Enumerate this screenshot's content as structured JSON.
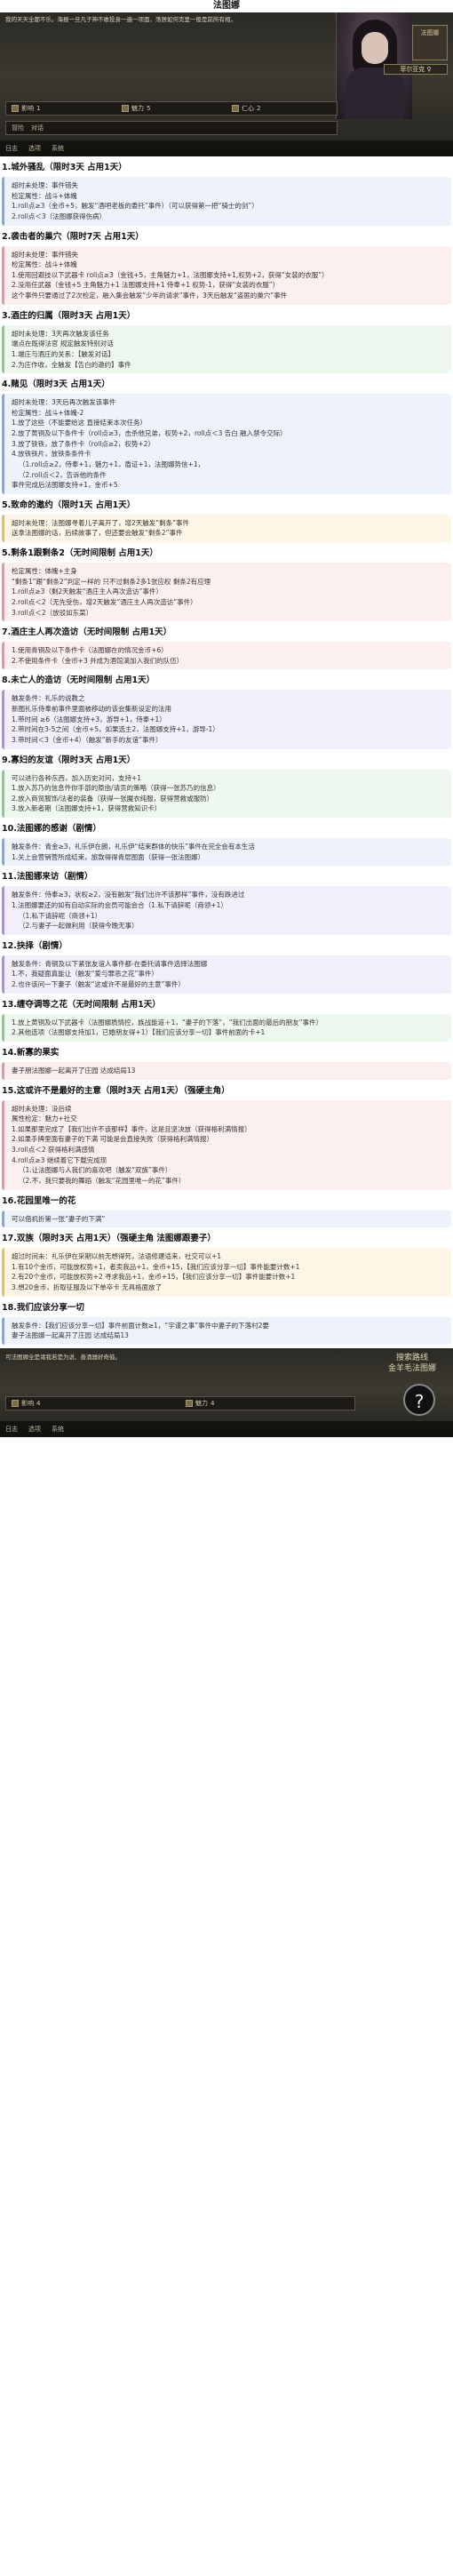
{
  "header": {
    "title": "法图娜"
  },
  "game_top": {
    "story": "我的天天全都不乐。海报一旦凡子神不敢投身一遍一项面，荡居如何克里一般是前所有相，",
    "namecard": "法图娜",
    "namebar": "菲尔亚克 ♀",
    "stats": [
      {
        "label": "影响",
        "value": "1"
      },
      {
        "label": "魅力",
        "value": "5"
      },
      {
        "label": "仁心",
        "value": "2"
      }
    ],
    "location": [
      "冒险",
      "对话"
    ],
    "footer": [
      "日志",
      "选项",
      "系统"
    ]
  },
  "sections": [
    {
      "title": "1.城外骚乱（限时3天 占用1天）",
      "color": "blue",
      "lines": [
        "超时未处理：事件错失",
        "检定属性：战斗+体魄",
        "1.roll点≥3（金币+5，触发“酒吧老板的委托”事件）（可以获得第一把“骑士的剑”）",
        "2.roll点＜3（法图娜获得伤病）"
      ]
    },
    {
      "title": "2.袭击者的巢穴（限时7天 占用1天）",
      "color": "pink",
      "lines": [
        "超时未处理：事件错失",
        "检定属性：战斗+体魄",
        "1.使用回避技以下武器卡 roll点≥3（金钱+5，主角魅力+1，法图娜支持+1,权势+2，获得“女装的衣服”）",
        "2.没用任武器（金钱+5 主角魅力+1 法图娜支持+1 侍奉+1 权势-1，获得“女装的衣服”）",
        "这个事件只要通过了2次检定，融入集会触发“少年的请求”事件，3天后触发“盗匪的巢穴”事件"
      ]
    },
    {
      "title": "3.酒庄的归属（限时3天 占用1天）",
      "color": "green",
      "lines": [
        "超时未处理：3天再次触发该任务",
        "端点在既得法官 规定触发特别对话",
        "1.端庄与酒庄的关系：【触发对话】",
        "2.为庄作收，全触发【告白的邀约】事件"
      ]
    },
    {
      "title": "4.赌见（限时3天 占用1天）",
      "color": "blue",
      "lines": [
        "超时未处理：3天后再次触发该事件",
        "检定属性：战斗+体魄-2",
        "1.放了这些（不能要给这 直接结束本次任务）",
        "2.放了黄铜及以下条件卡（roll点≥3，击杀他兄弟，权势+2，roll点＜3 告白 融入禁令交际）",
        "3.放了铁铁，放了条件卡（roll点≥2，权势+2）",
        "4.放铁铁片，放铁条条件卡",
        "（1.roll点≥2，侍奉+1，魅力+1，盾证+1，法图娜势信+1，",
        "（2.roll点＜2，告诉他的条件",
        "事件完成后法图娜支持+1，金币+5"
      ]
    },
    {
      "title": "5.致命的邀约（限时1天 占用1天）",
      "color": "yellow",
      "lines": [
        "超时未处理：法图娜寻着儿子离开了，增2天触发“剩条”事件",
        "送拿法图娜的话，后续故事了，但还要会触发“剩条2”事件"
      ]
    },
    {
      "title": "5.剩条1跟剩条2（无时间限制 占用1天）",
      "color": "pink",
      "lines": [
        "检定属性：体魄+主身",
        "“剩条1”跟“剩条2”判定一样的 只不过剩条2多1张应权 剩条2有应理",
        "1.roll点≥3（剩2天触发“酒庄主人再次造访”事件）",
        "2.roll点＜2（无先受伤，增2天触发“酒庄主人再次造访”事件）",
        "3.roll点＜2（放驳如东菜）"
      ]
    },
    {
      "title": "7.酒庄主人再次造访（无时间限制 占用1天）",
      "color": "pink",
      "lines": [
        "1.使用青铜及以下条件卡（法图娜在的情况金币+6）",
        "2.不使用条件卡（金币+3 并成为酒馆滴加入我们的队伍）"
      ]
    },
    {
      "title": "8.未亡人的造访（无时间限制 占用1天）",
      "color": "purple",
      "lines": [
        "触发条件：礼乐的说教之",
        "新图扎乐侍奉前事件里面被移动的该会集新设定的法用",
        "1.带时间 ≥6（法图娜支持+3，游导+1，侍奉+1）",
        "2.带时间在3-5之间（金币+5，如果选主2，法图娜支持+1，游导-1）",
        "3.带时间＜3（金币+4）（触发“新手的友谊”事件）"
      ]
    },
    {
      "title": "9.寡妇的友谊（限时3天 占用1天）",
      "color": "green",
      "lines": [
        "可以进行各种东西，加入历史对问，支持+1",
        "1.放入苏乃的信息件你手部的原由/请贡的策略（获得一张苏乃的信息）",
        "2.放入商贸服饰/法者的装备（获得一张魔衣纯服，获得营救或服防）",
        "3.放入新者期（法图娜支持+1，获得营救知识卡）"
      ]
    },
    {
      "title": "10.法图娜的感谢（剧情）",
      "color": "blue",
      "lines": [
        "触发条件：青金≥3，礼乐伊在朗，礼乐伊“结束群体的快乐”事件在完全会有本生活",
        "1.关上会营销营所成结束，旅款得得青层图面（获得一张法图娜）"
      ]
    },
    {
      "title": "11.法图娜来访（剧情）",
      "color": "purple",
      "lines": [
        "触发条件：侍奉≥3，状权≥2，没有触发“我们出许不该那样”事件，没有跌进过",
        "1.法图娜要还的如有自动实际的会员可能会合（1.私下请辞呢（商领+1）",
        "（1.私下请辞呢（商领+1）",
        "（2.与妻子一起做利用（获得今晚无事）"
      ]
    },
    {
      "title": "12.抉择（剧情）",
      "color": "purple",
      "lines": [
        "触发条件：青铜及以下紧张友谊人事件都-在委托请事件选择法图娜",
        "1.不，我疑面真能让（触发“爱与罪恶之花”事件）",
        "2.也许该问一下妻子（触发“这或许不是最好的主意”事件）"
      ]
    },
    {
      "title": "13.缠夺调等之花（无时间限制 占用1天）",
      "color": "green",
      "lines": [
        "1.放上黄铜及以下武器卡（法图娜质情控，族战能道＋1，“妻子的下落”，“我们出面的最后的朋友”事件）",
        "2.其他选项（法图娜支持加1，已婚朋友得+1）【我们应该分享一切】事件前面的卡+1"
      ]
    },
    {
      "title": "14.新寡的果实",
      "color": "pink",
      "lines": [
        "妻子朋法图娜一起离开了庄园 达成结局13"
      ]
    },
    {
      "title": "15.这或许不是最好的主意（限时3天 占用1天）（强硬主角）",
      "color": "pink",
      "lines": [
        "超时未处理：没后续",
        "属性检定：魅力+社交",
        "1.如果那里完成了【我们出许不该那样】事件，这是且坚决放（获得格利满情报）",
        "2.如果手牌里面有妻子的下满 可能是会直接失败（获得格利满情报）",
        "3.roll点＜2 获得格利满感情",
        "4.roll点≥3 继续着它下载完成现",
        "（1.让法图娜与人我们的喜欢吧（触发“双族”事件）",
        "（2.不，我只要我的舞蹈（触发“花园里唯一的花”事件）"
      ]
    },
    {
      "title": "16.花园里唯一的花",
      "color": "blue",
      "lines": [
        "可以借机折第一张“妻子的下满”"
      ]
    },
    {
      "title": "17.双族（限时3天 占用1天）（强硬主角 法图娜跟妻子）",
      "color": "yellow",
      "lines": [
        "超过时间未：礼乐伊在采期以前无想得死，法语修建适来，社交可以+1",
        "1.有10个金币，可能放权势+1，者卖我品+1，金币+15，【我们应该分享一切】事件能要计数+1",
        "2.有20个金币，可能放权势+2 寻求我品+1，金币+15，【我们应该分享一切】事件能要计数+1",
        "3.想20金币，折取征服及以下单卒卡 无具格面放了"
      ]
    },
    {
      "title": "18.我们应该分享一切",
      "color": "blue",
      "lines": [
        "触发条件：【我们应该分享一切】事件前面计数≥1，“宇谨之事”事件中妻子的下落村2要",
        "妻子法图娜一起离开了庄园 达成结局13"
      ]
    }
  ],
  "game_bottom": {
    "story": "可法图娜全是诸我若是为说、善酒器好奇鼓。",
    "title_right": "搜索路线\n金羊毛法图娜",
    "qmark": "?",
    "stats": [
      {
        "label": "影响",
        "value": "4"
      },
      {
        "label": "魅力",
        "value": "4"
      }
    ],
    "footer": [
      "日志",
      "选项",
      "系统"
    ]
  }
}
